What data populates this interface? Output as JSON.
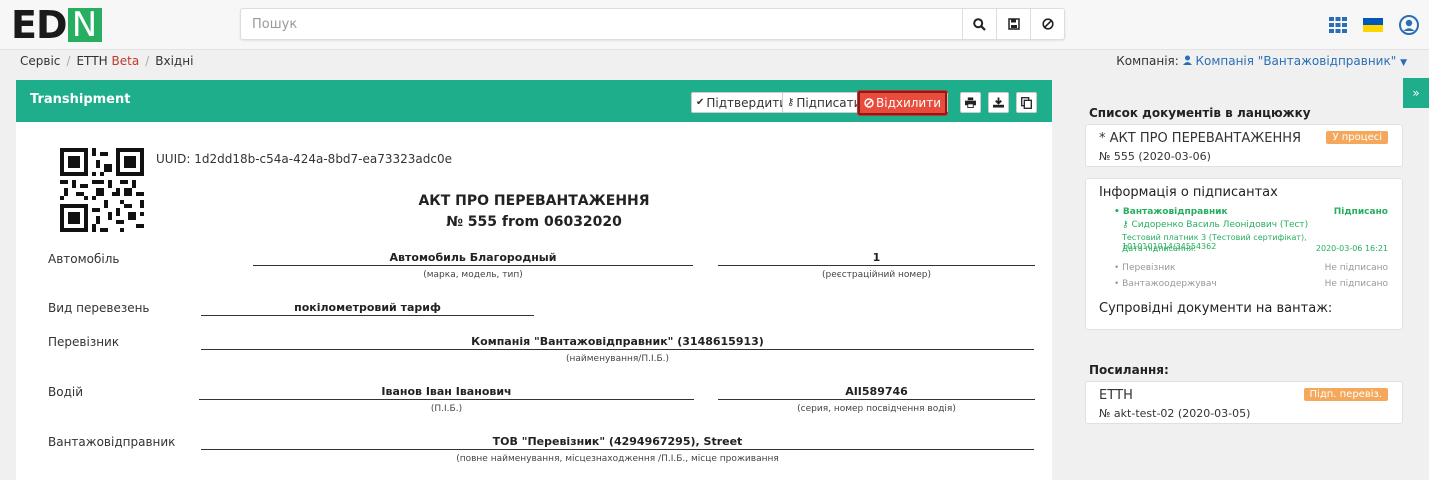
{
  "app": {
    "logo": "ED",
    "logo_mark": "N",
    "logo_colors": {
      "dark": "#1a1a1a",
      "accent": "#27ae60"
    }
  },
  "search": {
    "placeholder": "Пошук"
  },
  "top_icons": [
    "search-icon",
    "save-icon",
    "cancel-icon",
    "apps-grid-icon",
    "ukraine-flag-icon",
    "user-icon"
  ],
  "breadcrumb": {
    "items": [
      "Сервіс",
      "ЕТТН",
      "Вхідні"
    ],
    "beta": "Beta"
  },
  "company": {
    "label": "Компанія:",
    "name": "Компанія \"Вантажовідправник\""
  },
  "document": {
    "header_title": "Transhipment",
    "buttons": {
      "confirm": "Підтвердити",
      "sign": "Підписати",
      "reject": "Відхилити"
    },
    "uuid": "UUID: 1d2dd18b-c54a-424a-8bd7-ea73323adc0e",
    "title": "АКТ ПРО ПЕРЕВАНТАЖЕННЯ",
    "number": "№ 555 from 06032020",
    "fields": {
      "car_label": "Автомобіль",
      "car_value": "Автомобиль Благородный",
      "car_hint": "(марка, модель, тип)",
      "reg_value": "1",
      "reg_hint": "(реєстраційний номер)",
      "transport_label": "Вид перевезень",
      "transport_value": "покілометровий тариф",
      "carrier_label": "Перевізник",
      "carrier_value": "Компанія \"Вантажовідправник\" (3148615913)",
      "carrier_hint": "(найменування/П.І.Б.)",
      "driver_label": "Водій",
      "driver_value": "Іванов Іван Іванович",
      "driver_hint": "(П.І.Б.)",
      "license_value": "АІІ589746",
      "license_hint": "(серия, номер посвідчення водія)",
      "shipper_label": "Вантажовідправник",
      "shipper_value": "ТОВ \"Перевізник\" (4294967295), Street",
      "shipper_hint": "(повне найменування, місцезнаходження /П.І.Б., місце проживання"
    }
  },
  "sidebar": {
    "chain_title": "Список документів в ланцюжку",
    "chain_doc": {
      "title": "* АКТ ПРО ПЕРЕВАНТАЖЕННЯ",
      "status": "У процесі",
      "sub": "№ 555 (2020-03-06)"
    },
    "signers_title": "Інформація о підписантах",
    "signers": {
      "s1_role": "Вантажовідправник",
      "s1_status": "Підписано",
      "s1_person": "Сидоренко Василь Леонідович (Тест)",
      "s1_cert": "Тестовий платник 3 (Тестовий сертифікат), 1010101014/34554362",
      "s1_date_label": "Дата підписання:",
      "s1_date": "2020-03-06 16:21",
      "s2_role": "Перевізник",
      "s2_status": "Не підписано",
      "s3_role": "Вантажоодержувач",
      "s3_status": "Не підписано"
    },
    "accompany_title": "Супровідні документи на вантаж:",
    "links_title": "Посилання:",
    "link_doc": {
      "title": "ЕТТН",
      "status": "Підп. перевіз.",
      "sub": "№ akt-test-02 (2020-03-05)"
    }
  },
  "colors": {
    "header_green": "#1fae8c",
    "reject_red": "#e74c3c",
    "badge_orange": "#f5a85c",
    "signed_green": "#27ae60",
    "link_blue": "#2a6fb5"
  }
}
